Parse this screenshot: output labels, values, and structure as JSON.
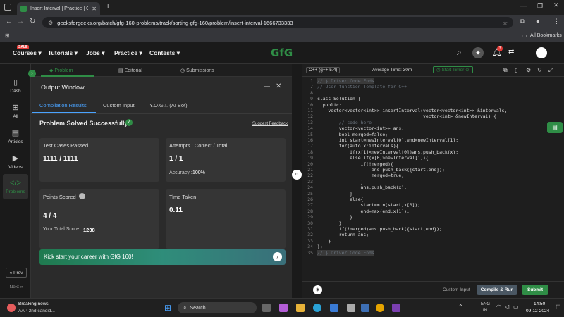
{
  "browser": {
    "tab_title": "Insert Interval | Practice | Geeks",
    "url": "geeksforgeeks.org/batch/gfg-160-problems/track/sorting-gfg-160/problem/insert-interval-1666733333",
    "all_bookmarks": "All Bookmarks"
  },
  "nav": {
    "sale_badge": "SALE",
    "courses": "Courses",
    "tutorials": "Tutorials",
    "jobs": "Jobs",
    "practice": "Practice",
    "contests": "Contests",
    "logo": "GfG",
    "notif_count": "3"
  },
  "rail": {
    "dash": "Dash",
    "all": "All",
    "articles": "Articles",
    "videos": "Videos",
    "problems": "Problems",
    "prev": "Prev",
    "next": "Next"
  },
  "problem_tabs": [
    "Problem",
    "Editorial",
    "Submissions"
  ],
  "output": {
    "title": "Output Window",
    "tabs": [
      "Compilation Results",
      "Custom Input",
      "Y.O.G.I. (AI Bot)"
    ],
    "status": "Problem Solved Successfully",
    "suggest_feedback": "Suggest Feedback",
    "test_cases_label": "Test Cases Passed",
    "test_cases_value": "1111 / 1111",
    "attempts_label": "Attempts : Correct / Total",
    "attempts_value": "1 / 1",
    "accuracy_label": "Accuracy :",
    "accuracy_value": "100%",
    "points_label": "Points Scored",
    "points_value": "4 / 4",
    "total_score_label": "Your Total Score:",
    "total_score_value": "1238",
    "time_label": "Time Taken",
    "time_value": "0.11",
    "banner": "Kick start your career with GfG 160!"
  },
  "editor": {
    "language": "C++ (g++ 5.4)",
    "avg_time": "Average Time: 30m",
    "start_timer": "Start Timer",
    "custom_input": "Custom Input",
    "compile_run": "Compile & Run",
    "submit": "Submit",
    "lines": [
      {
        "n": "1",
        "t": "// } Driver Code Ends",
        "c": "cm hl"
      },
      {
        "n": "7",
        "t": "// User function Template for C++",
        "c": "cm"
      },
      {
        "n": "8",
        "t": "",
        "c": ""
      },
      {
        "n": "9",
        "t": "class Solution {",
        "c": ""
      },
      {
        "n": "10",
        "t": "  public:",
        "c": ""
      },
      {
        "n": "11",
        "t": "    vector<vector<int>> insertInterval(vector<vector<int>> &intervals,",
        "c": ""
      },
      {
        "n": "12",
        "t": "                                       vector<int> &newInterval) {",
        "c": ""
      },
      {
        "n": "13",
        "t": "        // code here",
        "c": "cm"
      },
      {
        "n": "14",
        "t": "        vector<vector<int>> ans;",
        "c": ""
      },
      {
        "n": "15",
        "t": "        bool merged=false;",
        "c": ""
      },
      {
        "n": "16",
        "t": "        int start=newInterval[0],end=newInterval[1];",
        "c": ""
      },
      {
        "n": "17",
        "t": "        for(auto x:intervals){",
        "c": ""
      },
      {
        "n": "18",
        "t": "            if(x[1]<newInterval[0])ans.push_back(x);",
        "c": ""
      },
      {
        "n": "19",
        "t": "            else if(x[0]>newInterval[1]){",
        "c": ""
      },
      {
        "n": "20",
        "t": "                if(!merged){",
        "c": ""
      },
      {
        "n": "21",
        "t": "                    ans.push_back({start,end});",
        "c": ""
      },
      {
        "n": "22",
        "t": "                    merged=true;",
        "c": ""
      },
      {
        "n": "23",
        "t": "                }",
        "c": ""
      },
      {
        "n": "24",
        "t": "                ans.push_back(x);",
        "c": ""
      },
      {
        "n": "25",
        "t": "            }",
        "c": ""
      },
      {
        "n": "26",
        "t": "            else{",
        "c": ""
      },
      {
        "n": "27",
        "t": "                start=min(start,x[0]);",
        "c": ""
      },
      {
        "n": "28",
        "t": "                end=max(end,x[1]);",
        "c": ""
      },
      {
        "n": "29",
        "t": "            }",
        "c": ""
      },
      {
        "n": "30",
        "t": "        }",
        "c": ""
      },
      {
        "n": "31",
        "t": "        if(!merged)ans.push_back({start,end});",
        "c": ""
      },
      {
        "n": "32",
        "t": "        return ans;",
        "c": ""
      },
      {
        "n": "33",
        "t": "    }",
        "c": ""
      },
      {
        "n": "34",
        "t": "};",
        "c": ""
      },
      {
        "n": "35",
        "t": "// } Driver Code Ends",
        "c": "cm hl"
      }
    ]
  },
  "taskbar": {
    "news_title": "Breaking news",
    "news_sub": "AAP 2nd candid...",
    "search": "Search",
    "lang": "ENG",
    "region": "IN",
    "time": "14:50",
    "date": "09-12-2024"
  },
  "colors": {
    "accent_green": "#2f8d46",
    "link_blue": "#4aa3ff"
  }
}
